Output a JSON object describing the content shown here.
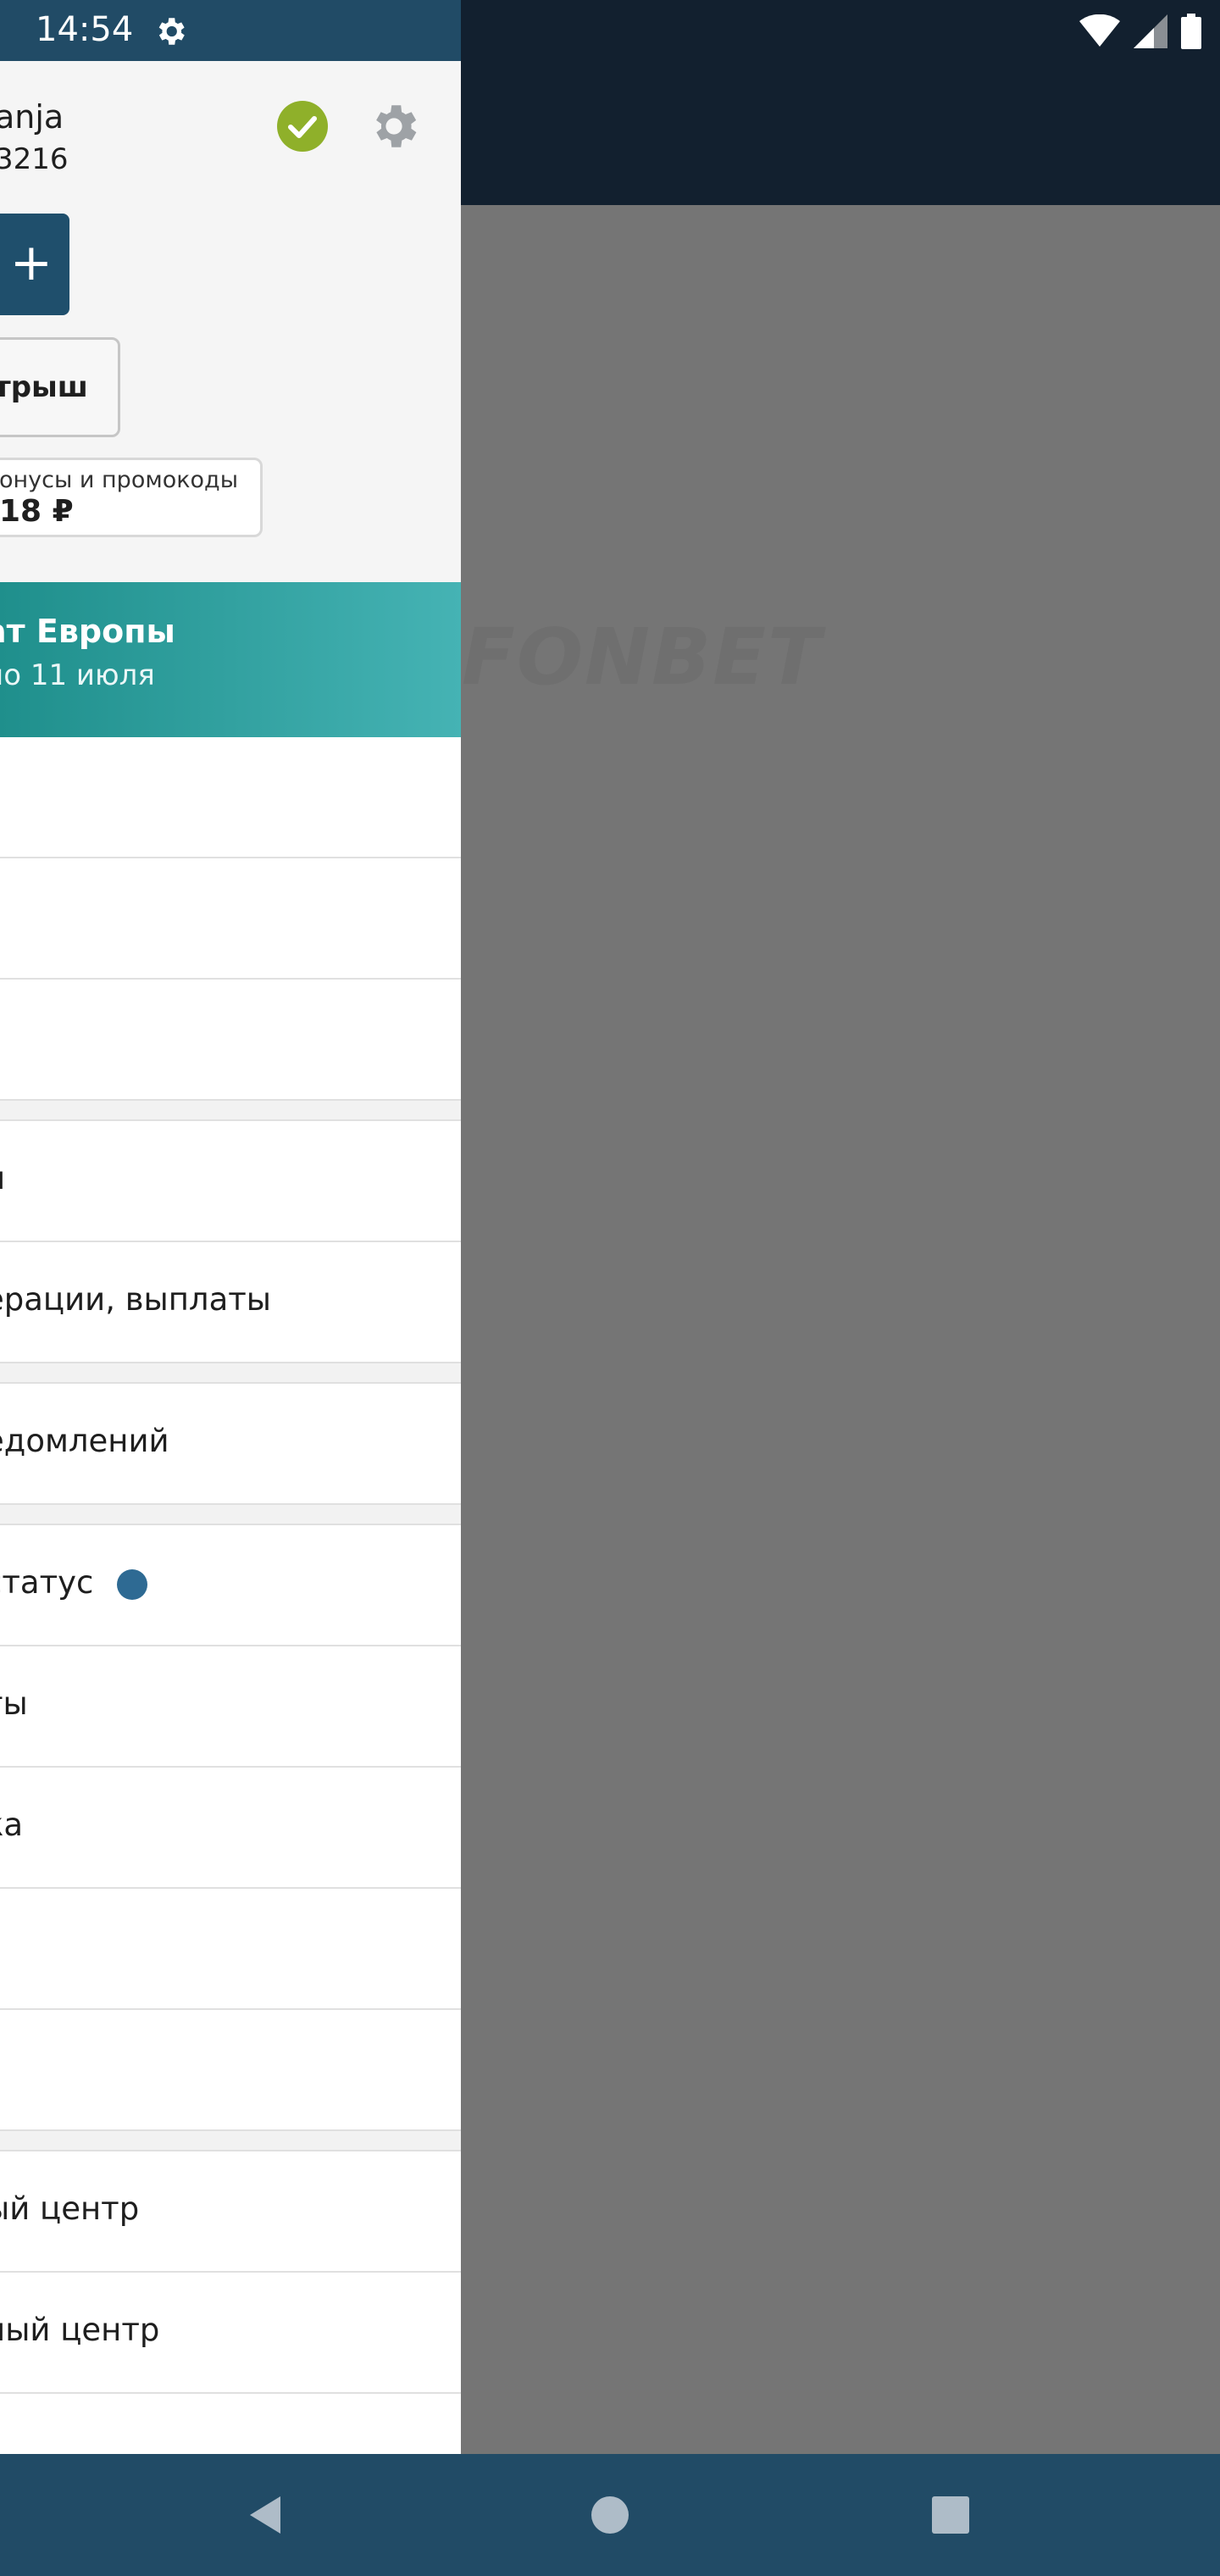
{
  "status_bar": {
    "time": "14:54",
    "icons": [
      "settings-icon",
      "wifi-icon",
      "signal-icon",
      "battery-icon"
    ]
  },
  "watermark": "FONBET",
  "drawer": {
    "user": {
      "name": "anja",
      "id": "3216"
    },
    "deposit_label": "+",
    "draw_button_label": "трыш",
    "bonus": {
      "label": "онусы и промокоды",
      "amount": "18 ₽"
    },
    "promo": {
      "title": "ат Европы",
      "subtitle": "по 11 июля"
    },
    "menu": [
      {
        "label": ""
      },
      {
        "label": ""
      },
      {
        "label": ""
      },
      {
        "separator": true
      },
      {
        "label": "н"
      },
      {
        "label": "ерации, выплаты"
      },
      {
        "separator": true
      },
      {
        "label": "едомлений"
      },
      {
        "separator": true
      },
      {
        "label": "статус",
        "dot": true
      },
      {
        "label": "ты"
      },
      {
        "label": "ка"
      },
      {
        "label": ""
      },
      {
        "label": ""
      },
      {
        "separator": true
      },
      {
        "label": "ый центр"
      },
      {
        "label": "ный центр"
      },
      {
        "label": ""
      }
    ]
  },
  "colors": {
    "header_dark": "#12202f",
    "status_left": "#214b66",
    "accent_blue": "#1f4f6c",
    "promo_gradient_start": "#1f8f8c",
    "promo_gradient_end": "#45b3b4",
    "verified_green": "#8fb02a",
    "overlay_grey": "#757575"
  },
  "nav_bar": {
    "buttons": [
      "back-icon",
      "home-icon",
      "recents-icon"
    ]
  }
}
